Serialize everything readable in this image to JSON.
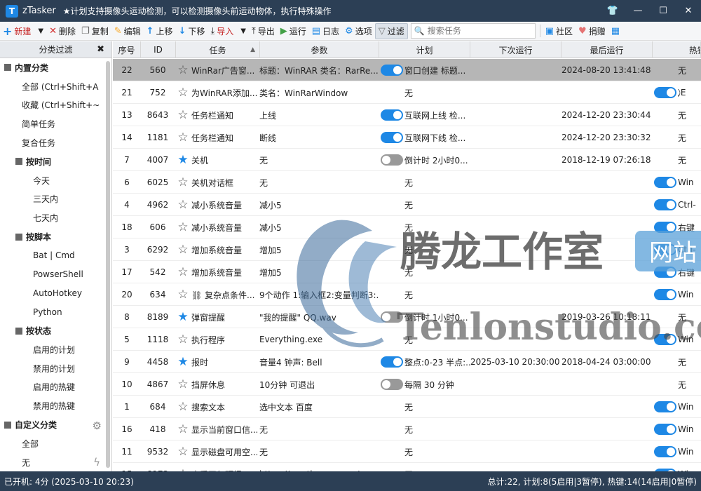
{
  "app": {
    "logo_letter": "T",
    "name": "zTasker",
    "tagline": "★计划支持摄像头运动检测，可以检测摄像头前运动物体，执行特殊操作"
  },
  "window_buttons": {
    "skin": "👕",
    "minimize": "—",
    "maximize": "☐",
    "close": "✕"
  },
  "toolbar": {
    "new_label": "新建",
    "delete_label": "删除",
    "copy_label": "复制",
    "edit_label": "编辑",
    "up_label": "上移",
    "down_label": "下移",
    "import_label": "导入",
    "export_label": "导出",
    "run_label": "运行",
    "log_label": "日志",
    "options_label": "选项",
    "filter_label": "过滤",
    "search_placeholder": "搜索任务",
    "community_label": "社区",
    "donate_label": "捐赠"
  },
  "sidebar": {
    "header": "分类过滤",
    "items": [
      {
        "label": "内置分类",
        "level": "g0",
        "box": true
      },
      {
        "label": "全部 (Ctrl+Shift+A",
        "level": "l1"
      },
      {
        "label": "收藏 (Ctrl+Shift+~",
        "level": "l1"
      },
      {
        "label": "简单任务",
        "level": "l1"
      },
      {
        "label": "复合任务",
        "level": "l1"
      },
      {
        "label": "按时间",
        "level": "g1",
        "box": true
      },
      {
        "label": "今天",
        "level": "l2"
      },
      {
        "label": "三天内",
        "level": "l2"
      },
      {
        "label": "七天内",
        "level": "l2"
      },
      {
        "label": "按脚本",
        "level": "g1",
        "box": true
      },
      {
        "label": "Bat | Cmd",
        "level": "l2"
      },
      {
        "label": "PowserShell",
        "level": "l2"
      },
      {
        "label": "AutoHotkey",
        "level": "l2"
      },
      {
        "label": "Python",
        "level": "l2"
      },
      {
        "label": "按状态",
        "level": "g1",
        "box": true
      },
      {
        "label": "启用的计划",
        "level": "l2"
      },
      {
        "label": "禁用的计划",
        "level": "l2"
      },
      {
        "label": "启用的热键",
        "level": "l2"
      },
      {
        "label": "禁用的热键",
        "level": "l2"
      },
      {
        "label": "自定义分类",
        "level": "g0",
        "box": true
      },
      {
        "label": "全部",
        "level": "l1"
      },
      {
        "label": "无",
        "level": "l1"
      }
    ]
  },
  "table": {
    "columns": [
      "序号",
      "ID",
      "任务",
      "参数",
      "计划",
      "下次运行",
      "最后运行",
      "热键"
    ],
    "sort_indicator": "▲",
    "rows": [
      {
        "seq": "22",
        "id": "560",
        "fav": false,
        "name": "WinRar广告窗...",
        "param": "标题：WinRAR 类名：RarRe...",
        "plan_toggle": "on",
        "plan": "窗口创建 标题...",
        "next": "",
        "last": "2024-08-20 13:41:48",
        "hot_toggle": "",
        "hot": "无",
        "selected": true
      },
      {
        "seq": "21",
        "id": "752",
        "fav": false,
        "name": "为WinRAR添加...",
        "param": "类名：WinRarWindow",
        "plan_toggle": "",
        "plan": "无",
        "next": "",
        "last": "",
        "hot_toggle": "on",
        "hot": "⃠ E",
        "selected": false
      },
      {
        "seq": "13",
        "id": "8643",
        "fav": false,
        "name": "任务栏通知",
        "param": "上线",
        "plan_toggle": "on",
        "plan": "互联网上线 检...",
        "next": "",
        "last": "2024-12-20 23:30:44",
        "hot_toggle": "",
        "hot": "无"
      },
      {
        "seq": "14",
        "id": "1181",
        "fav": false,
        "name": "任务栏通知",
        "param": "断线",
        "plan_toggle": "on",
        "plan": "互联网下线 检...",
        "next": "",
        "last": "2024-12-20 23:30:32",
        "hot_toggle": "",
        "hot": "无"
      },
      {
        "seq": "7",
        "id": "4007",
        "fav": true,
        "name": "关机",
        "param": "无",
        "plan_toggle": "off",
        "plan": "倒计时 2小时0...",
        "next": "",
        "last": "2018-12-19 07:26:18",
        "hot_toggle": "",
        "hot": "无"
      },
      {
        "seq": "6",
        "id": "6025",
        "fav": false,
        "name": "关机对话框",
        "param": "无",
        "plan_toggle": "",
        "plan": "无",
        "next": "",
        "last": "",
        "hot_toggle": "on",
        "hot": "Win"
      },
      {
        "seq": "4",
        "id": "4962",
        "fav": false,
        "name": "减小系统音量",
        "param": "减小5",
        "plan_toggle": "",
        "plan": "无",
        "next": "",
        "last": "",
        "hot_toggle": "on",
        "hot": "Ctrl-"
      },
      {
        "seq": "18",
        "id": "606",
        "fav": false,
        "name": "减小系统音量",
        "param": "减小5",
        "plan_toggle": "",
        "plan": "无",
        "next": "",
        "last": "",
        "hot_toggle": "on",
        "hot": "右键"
      },
      {
        "seq": "3",
        "id": "6292",
        "fav": false,
        "name": "增加系统音量",
        "param": "增加5",
        "plan_toggle": "",
        "plan": "无",
        "next": "",
        "last": "",
        "hot_toggle": "on",
        "hot": "Ctrl-"
      },
      {
        "seq": "17",
        "id": "542",
        "fav": false,
        "name": "增加系统音量",
        "param": "增加5",
        "plan_toggle": "",
        "plan": "无",
        "next": "",
        "last": "",
        "hot_toggle": "on",
        "hot": "右键"
      },
      {
        "seq": "20",
        "id": "634",
        "fav": false,
        "name": "⛓ 复杂点条件...",
        "param": "9个动作 1:输入框2:变量判断3:...",
        "plan_toggle": "",
        "plan": "无",
        "next": "",
        "last": "",
        "hot_toggle": "on",
        "hot": "Win"
      },
      {
        "seq": "8",
        "id": "8189",
        "fav": true,
        "name": "弹窗提醒",
        "param": "\"我的提醒\" QQ.wav",
        "plan_toggle": "off",
        "plan": "倒计时 1小时0...",
        "next": "",
        "last": "2019-03-26 10:18:11",
        "hot_toggle": "",
        "hot": "无"
      },
      {
        "seq": "5",
        "id": "1118",
        "fav": false,
        "name": "执行程序",
        "param": "Everything.exe",
        "plan_toggle": "",
        "plan": "无",
        "next": "",
        "last": "",
        "hot_toggle": "on",
        "hot": "Win"
      },
      {
        "seq": "9",
        "id": "4458",
        "fav": true,
        "name": "报时",
        "param": "音量4 钟声: Bell",
        "plan_toggle": "on",
        "plan": "整点:0-23 半点:...",
        "next": "2025-03-10 20:30:00",
        "last": "2018-04-24 03:00:00",
        "hot_toggle": "",
        "hot": "无"
      },
      {
        "seq": "10",
        "id": "4867",
        "fav": false,
        "name": "挡屏休息",
        "param": "10分钟 可退出",
        "plan_toggle": "off",
        "plan": "每隔 30 分钟",
        "next": "",
        "last": "",
        "hot_toggle": "",
        "hot": "无"
      },
      {
        "seq": "1",
        "id": "684",
        "fav": false,
        "name": "搜索文本",
        "param": "选中文本 百度",
        "plan_toggle": "",
        "plan": "无",
        "next": "",
        "last": "",
        "hot_toggle": "on",
        "hot": "Win"
      },
      {
        "seq": "16",
        "id": "418",
        "fav": false,
        "name": "显示当前窗口信...",
        "param": "无",
        "plan_toggle": "",
        "plan": "无",
        "next": "",
        "last": "",
        "hot_toggle": "on",
        "hot": "Win"
      },
      {
        "seq": "11",
        "id": "9532",
        "fav": false,
        "name": "显示磁盘可用空...",
        "param": "无",
        "plan_toggle": "",
        "plan": "无",
        "next": "",
        "last": "",
        "hot_toggle": "on",
        "hot": "Win"
      },
      {
        "seq": "15",
        "id": "8173",
        "fav": false,
        "name": "查看天气预报",
        "param": "https://weather.com.cn/...",
        "plan_toggle": "",
        "plan": "无",
        "next": "",
        "last": "",
        "hot_toggle": "on",
        "hot": "Win"
      }
    ]
  },
  "watermark": {
    "title": "腾龙工作室",
    "badge": "网站",
    "url": "Tenlonstudio.com"
  },
  "status": {
    "left": "已开机: 4分 (2025-03-10 20:23)",
    "right": "总计:22, 计划:8(5启用|3暂停), 热键:14(14启用|0暂停)"
  }
}
